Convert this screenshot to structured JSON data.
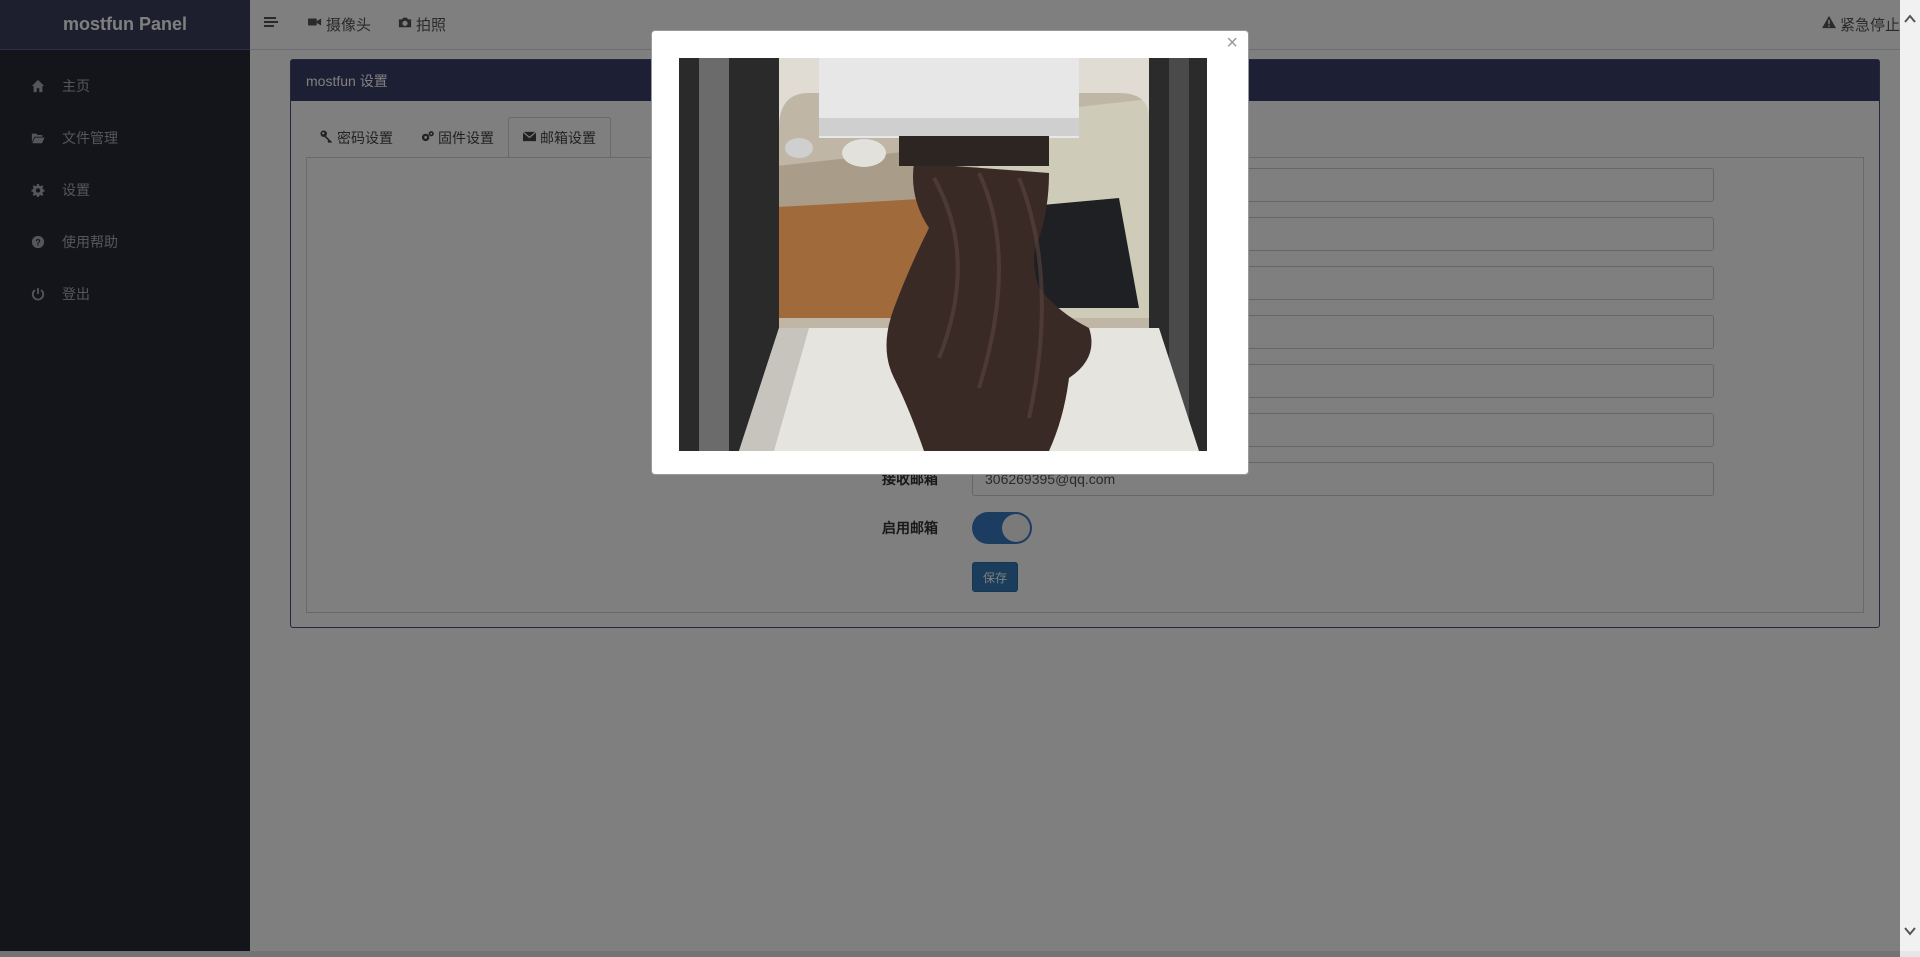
{
  "app": {
    "brand": "mostfun Panel"
  },
  "sidebar": {
    "items": [
      {
        "label": "主页",
        "icon": "home-icon"
      },
      {
        "label": "文件管理",
        "icon": "folder-open-icon"
      },
      {
        "label": "设置",
        "icon": "gear-icon"
      },
      {
        "label": "使用帮助",
        "icon": "question-circle-icon"
      },
      {
        "label": "登出",
        "icon": "power-icon"
      }
    ]
  },
  "topbar": {
    "menu_icon": "menu-icon",
    "camera_label": "摄像头",
    "photo_label": "拍照",
    "estop_label": "紧急停止"
  },
  "panel": {
    "title": "mostfun 设置"
  },
  "tabs": [
    {
      "label": "密码设置",
      "icon": "key-icon"
    },
    {
      "label": "固件设置",
      "icon": "cogs-icon"
    },
    {
      "label": "邮箱设置",
      "icon": "envelope-icon",
      "active": true
    }
  ],
  "email_form": {
    "receiver_label": "接收邮箱",
    "receiver_value": "306269395@qq.com",
    "enable_label": "启用邮箱",
    "enabled": true,
    "save_label": "保存"
  },
  "modal": {
    "close_label": "×",
    "image_subject": "camera-snapshot-3d-printed-vase"
  },
  "colors": {
    "sidebar_bg": "#272b35",
    "brand_bg": "#3a3e5e",
    "panel_heading_bg": "#3a3e68",
    "primary": "#337ab7",
    "toggle_on": "#3a78c3"
  }
}
